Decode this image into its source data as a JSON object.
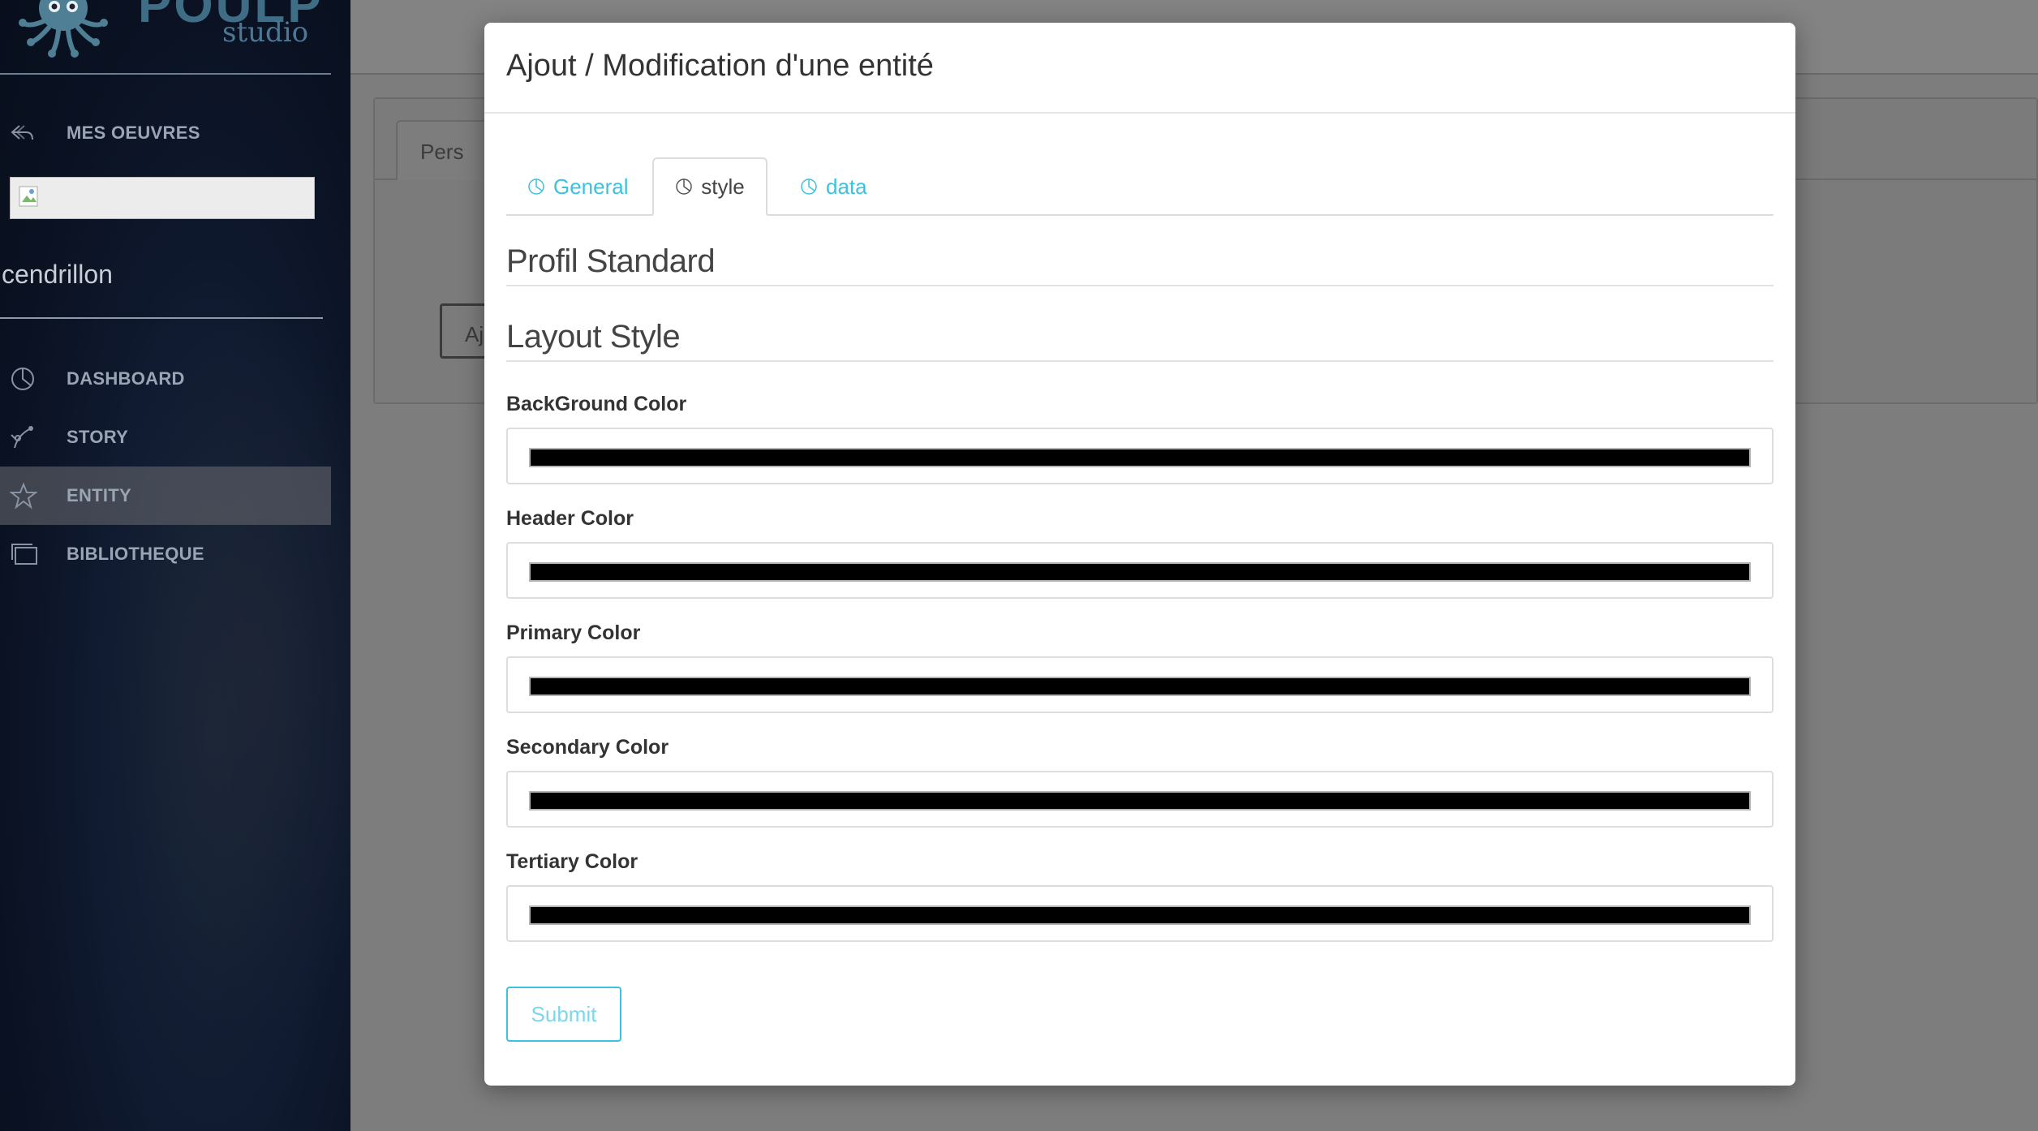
{
  "brand": {
    "name": "POULP",
    "sub": "studio"
  },
  "sidebar": {
    "back": {
      "label": "MES OEUVRES",
      "icon": "reply-arrow-icon"
    },
    "username": "cendrillon",
    "items": [
      {
        "label": "DASHBOARD",
        "icon": "pie-chart-icon"
      },
      {
        "label": "STORY",
        "icon": "branch-icon"
      },
      {
        "label": "ENTITY",
        "icon": "star-icon",
        "active": true
      },
      {
        "label": "BIBLIOTHEQUE",
        "icon": "layers-icon"
      }
    ]
  },
  "background": {
    "tab_label": "Pers",
    "button_label": "Aj"
  },
  "modal": {
    "title": "Ajout / Modification d'une entité",
    "tabs": [
      {
        "label": "General",
        "icon": "pie-chart-icon"
      },
      {
        "label": "style",
        "icon": "pie-chart-icon",
        "active": true
      },
      {
        "label": "data",
        "icon": "pie-chart-icon"
      }
    ],
    "section_profile": "Profil Standard",
    "section_layout": "Layout Style",
    "fields": [
      {
        "label": "BackGround Color",
        "value": "#000000"
      },
      {
        "label": "Header Color",
        "value": "#000000"
      },
      {
        "label": "Primary Color",
        "value": "#000000"
      },
      {
        "label": "Secondary Color",
        "value": "#000000"
      },
      {
        "label": "Tertiary Color",
        "value": "#000000"
      }
    ],
    "submit_label": "Submit"
  },
  "colors": {
    "accent": "#3cc2e0",
    "sidebar_bg": "#0c1528",
    "overlay": "#7d7d7d"
  }
}
